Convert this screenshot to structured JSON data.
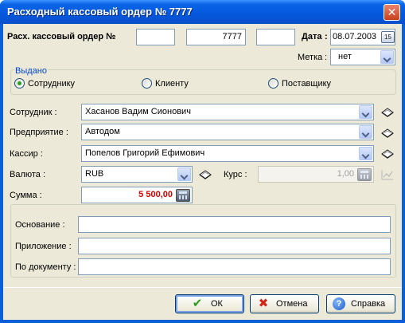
{
  "window": {
    "title": "Расходный кассовый ордер № 7777",
    "close_glyph": "✕"
  },
  "header": {
    "order_label": "Расх. кассовый ордер №",
    "order_prefix": "",
    "order_number": "7777",
    "order_suffix": "",
    "date_label": "Дата",
    "date_value": "08.07.2003",
    "mark_label": "Метка",
    "mark_value": "нет",
    "calendar_icon_text": "15"
  },
  "issued_group": {
    "title": "Выдано",
    "options": [
      {
        "label": "Сотруднику",
        "checked": true
      },
      {
        "label": "Клиенту",
        "checked": false
      },
      {
        "label": "Поставщику",
        "checked": false
      }
    ]
  },
  "fields": {
    "employee_label": "Сотрудник :",
    "employee_value": "Хасанов Вадим Сионович",
    "enterprise_label": "Предприятие :",
    "enterprise_value": "Автодом",
    "cashier_label": "Кассир :",
    "cashier_value": "Попелов Григорий Ефимович",
    "currency_label": "Валюта :",
    "currency_value": "RUB",
    "rate_label": "Курс :",
    "rate_value": "1,00",
    "amount_label": "Сумма :",
    "amount_value": "5 500,00"
  },
  "details": {
    "basis_label": "Основание :",
    "basis_value": "",
    "attachment_label": "Приложение :",
    "attachment_value": "",
    "document_label": "По документу :",
    "document_value": ""
  },
  "buttons": {
    "ok_label": "ОК",
    "cancel_label": "Отмена",
    "help_label": "Справка"
  },
  "colors": {
    "amount_text": "#d40000",
    "group_title": "#0046d5",
    "titlebar": "#0558de",
    "ok_check": "#2c9a1f",
    "cancel_cross": "#d0261a"
  }
}
